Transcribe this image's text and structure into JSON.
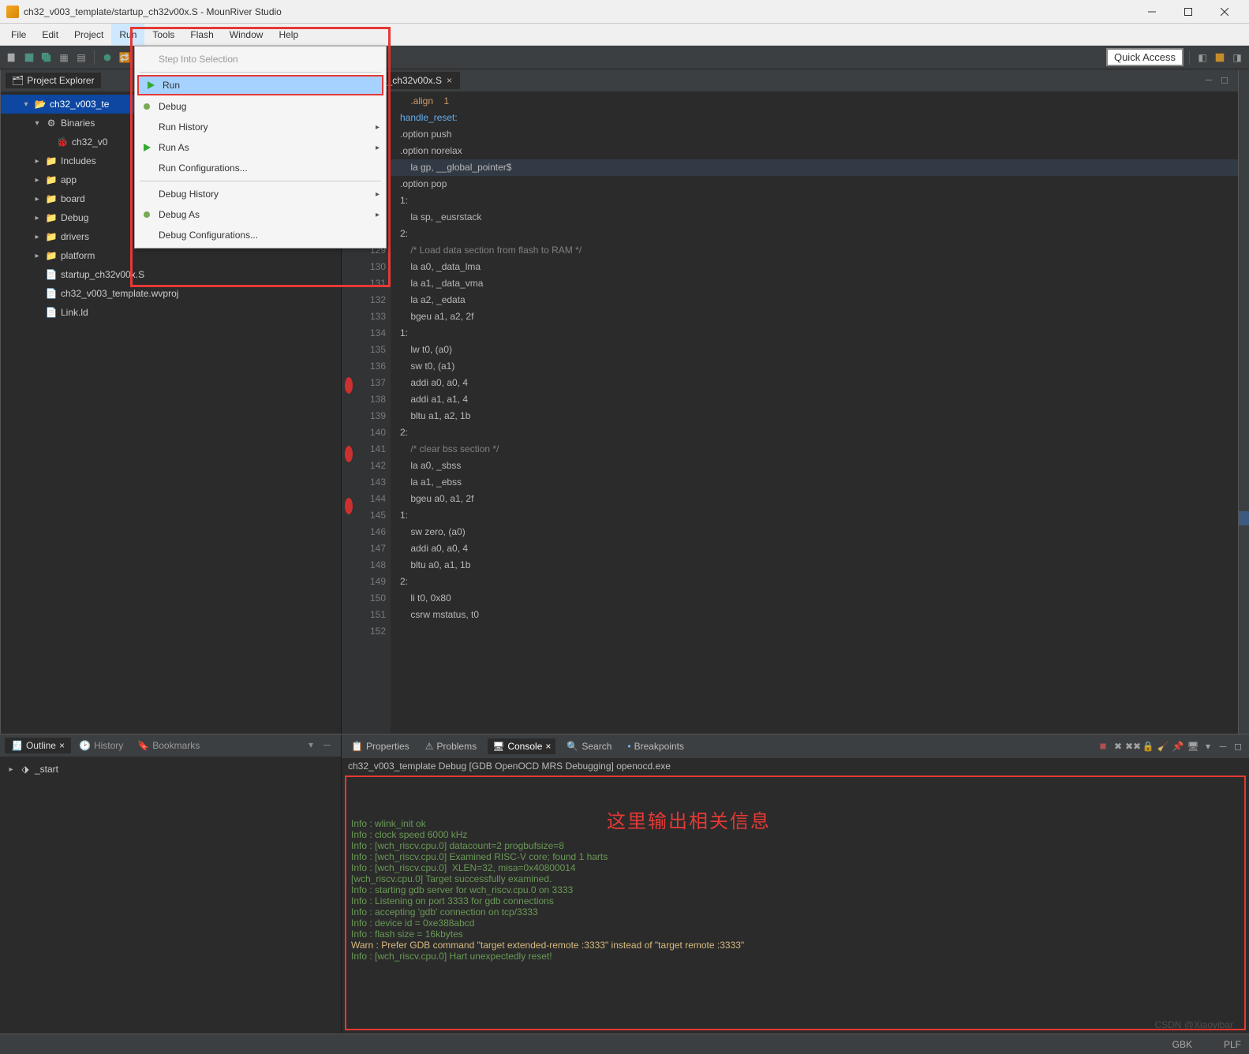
{
  "window": {
    "title": "ch32_v003_template/startup_ch32v00x.S - MounRiver Studio"
  },
  "menu": {
    "items": [
      "File",
      "Edit",
      "Project",
      "Run",
      "Tools",
      "Flash",
      "Window",
      "Help"
    ],
    "openIndex": 3,
    "run_dropdown": [
      {
        "label": "Step Into Selection",
        "disabled": true
      },
      {
        "sep": true
      },
      {
        "label": "Run",
        "icon": "play",
        "highlight": true
      },
      {
        "label": "Debug",
        "icon": "bug"
      },
      {
        "label": "Run History",
        "sub": true
      },
      {
        "label": "Run As",
        "icon": "play-small",
        "sub": true
      },
      {
        "label": "Run Configurations..."
      },
      {
        "sep": true
      },
      {
        "label": "Debug History",
        "sub": true
      },
      {
        "label": "Debug As",
        "icon": "bug-small",
        "sub": true
      },
      {
        "label": "Debug Configurations..."
      }
    ]
  },
  "quickAccess": "Quick Access",
  "projectExplorer": {
    "title": "Project Explorer",
    "tree": [
      {
        "d": 0,
        "exp": "▾",
        "icon": "proj",
        "label": "ch32_v003_te",
        "selected": true
      },
      {
        "d": 1,
        "exp": "▾",
        "icon": "bin",
        "label": "Binaries"
      },
      {
        "d": 2,
        "exp": "",
        "icon": "bug",
        "label": "ch32_v0"
      },
      {
        "d": 1,
        "exp": "▸",
        "icon": "folder",
        "label": "Includes"
      },
      {
        "d": 1,
        "exp": "▸",
        "icon": "folder",
        "label": "app"
      },
      {
        "d": 1,
        "exp": "▸",
        "icon": "folder",
        "label": "board"
      },
      {
        "d": 1,
        "exp": "▸",
        "icon": "folder",
        "label": "Debug"
      },
      {
        "d": 1,
        "exp": "▸",
        "icon": "folder",
        "label": "drivers"
      },
      {
        "d": 1,
        "exp": "▸",
        "icon": "folder",
        "label": "platform"
      },
      {
        "d": 1,
        "exp": "",
        "icon": "file",
        "label": "startup_ch32v00x.S"
      },
      {
        "d": 1,
        "exp": "",
        "icon": "file",
        "label": "ch32_v003_template.wvproj"
      },
      {
        "d": 1,
        "exp": "",
        "icon": "file",
        "label": "Link.ld"
      }
    ]
  },
  "editor": {
    "tab": "rtup_ch32v00x.S",
    "startLine": 120,
    "breakpointLines": [
      137,
      141,
      144
    ],
    "highlightLine": 124,
    "lines": [
      {
        "t": "    .align    1",
        "c": "d-orange",
        "suf": ""
      },
      {
        "t": "handle_reset:",
        "c": "d-blue",
        "suf": ""
      },
      {
        "t": ".option push",
        "c": "",
        "suf": ""
      },
      {
        "t": ".option norelax",
        "c": "",
        "suf": ""
      },
      {
        "t": "    la gp, __global_pointer$",
        "c": "",
        "suf": ""
      },
      {
        "t": ".option pop",
        "c": "",
        "suf": ""
      },
      {
        "t": "1:",
        "c": "",
        "suf": ""
      },
      {
        "t": "    la sp, _eusrstack",
        "c": "",
        "suf": ""
      },
      {
        "t": "2:",
        "c": "",
        "suf": ""
      },
      {
        "t": "    /* Load data section from flash to RAM */",
        "c": "d-grey",
        "suf": ""
      },
      {
        "t": "    la a0, _data_lma",
        "c": "",
        "suf": ""
      },
      {
        "t": "    la a1, _data_vma",
        "c": "",
        "suf": ""
      },
      {
        "t": "    la a2, _edata",
        "c": "",
        "suf": ""
      },
      {
        "t": "    bgeu a1, a2, 2f",
        "c": "",
        "suf": ""
      },
      {
        "t": "1:",
        "c": "",
        "suf": ""
      },
      {
        "t": "    lw t0, (a0)",
        "c": "",
        "suf": ""
      },
      {
        "t": "    sw t0, (a1)",
        "c": "",
        "suf": ""
      },
      {
        "t": "    addi a0, a0, 4",
        "c": "",
        "suf": ""
      },
      {
        "t": "    addi a1, a1, 4",
        "c": "",
        "suf": ""
      },
      {
        "t": "    bltu a1, a2, 1b",
        "c": "",
        "suf": ""
      },
      {
        "t": "2:",
        "c": "",
        "suf": ""
      },
      {
        "t": "    /* clear bss section */",
        "c": "d-grey",
        "suf": ""
      },
      {
        "t": "    la a0, _sbss",
        "c": "",
        "suf": ""
      },
      {
        "t": "    la a1, _ebss",
        "c": "",
        "suf": ""
      },
      {
        "t": "    bgeu a0, a1, 2f",
        "c": "",
        "suf": ""
      },
      {
        "t": "1:",
        "c": "",
        "suf": ""
      },
      {
        "t": "    sw zero, (a0)",
        "c": "",
        "suf": ""
      },
      {
        "t": "    addi a0, a0, 4",
        "c": "",
        "suf": ""
      },
      {
        "t": "    bltu a0, a1, 1b",
        "c": "",
        "suf": ""
      },
      {
        "t": "2:",
        "c": "",
        "suf": ""
      },
      {
        "t": "    li t0, 0x80",
        "c": "",
        "suf": ""
      },
      {
        "t": "    csrw mstatus, t0",
        "c": "",
        "suf": ""
      },
      {
        "t": "",
        "c": "",
        "suf": ""
      }
    ]
  },
  "outline": {
    "tabs": [
      "Outline",
      "History",
      "Bookmarks"
    ],
    "item": "_start"
  },
  "bottom": {
    "tabs": [
      "Properties",
      "Problems",
      "Console",
      "Search",
      "Breakpoints"
    ],
    "active": 2,
    "consoleTitle": "ch32_v003_template Debug [GDB OpenOCD MRS Debugging] openocd.exe",
    "overlay": "这里输出相关信息",
    "lines": [
      "Info : wlink_init ok",
      "Info : clock speed 6000 kHz",
      "Info : [wch_riscv.cpu.0] datacount=2 progbufsize=8",
      "Info : [wch_riscv.cpu.0] Examined RISC-V core; found 1 harts",
      "Info : [wch_riscv.cpu.0]  XLEN=32, misa=0x40800014",
      "[wch_riscv.cpu.0] Target successfully examined.",
      "Info : starting gdb server for wch_riscv.cpu.0 on 3333",
      "Info : Listening on port 3333 for gdb connections",
      "Info : accepting 'gdb' connection on tcp/3333",
      "Info : device id = 0xe388abcd",
      "Info : flash size = 16kbytes",
      "Warn : Prefer GDB command \"target extended-remote :3333\" instead of \"target remote :3333\"",
      "Info : [wch_riscv.cpu.0] Hart unexpectedly reset!"
    ]
  },
  "status": {
    "encoding": "GBK",
    "end": "PLF"
  },
  "watermark": "CSDN @Xiaoyibar"
}
